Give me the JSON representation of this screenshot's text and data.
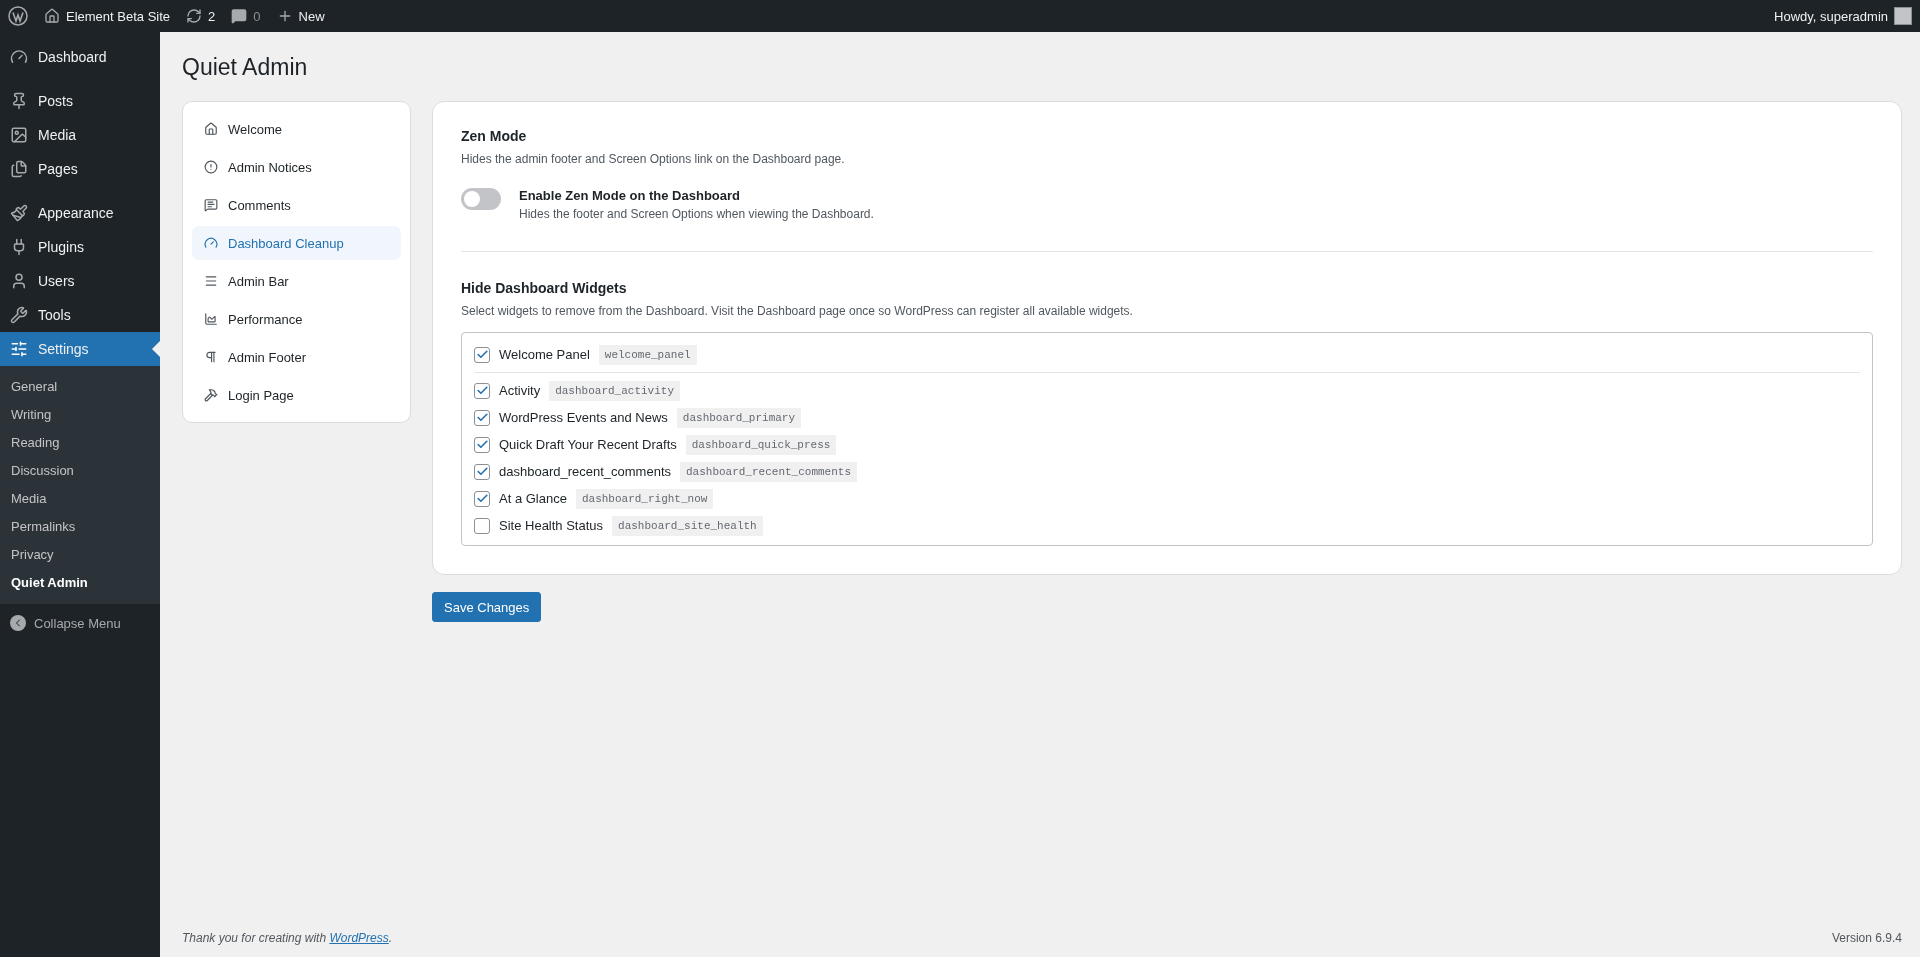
{
  "admin_bar": {
    "site_name": "Element Beta Site",
    "updates": "2",
    "comments": "0",
    "new_label": "New",
    "greeting": "Howdy, superadmin"
  },
  "sidebar": {
    "groups": [
      {
        "items": [
          {
            "label": "Dashboard",
            "selected": false
          }
        ]
      },
      {
        "items": [
          {
            "label": "Posts",
            "selected": false
          },
          {
            "label": "Media",
            "selected": false
          },
          {
            "label": "Pages",
            "selected": false
          }
        ]
      },
      {
        "items": [
          {
            "label": "Appearance",
            "selected": false
          },
          {
            "label": "Plugins",
            "selected": false
          },
          {
            "label": "Users",
            "selected": false
          },
          {
            "label": "Tools",
            "selected": false
          },
          {
            "label": "Settings",
            "selected": true
          }
        ]
      }
    ],
    "submenu": [
      {
        "label": "General",
        "selected": false
      },
      {
        "label": "Writing",
        "selected": false
      },
      {
        "label": "Reading",
        "selected": false
      },
      {
        "label": "Discussion",
        "selected": false
      },
      {
        "label": "Media",
        "selected": false
      },
      {
        "label": "Permalinks",
        "selected": false
      },
      {
        "label": "Privacy",
        "selected": false
      },
      {
        "label": "Quiet Admin",
        "selected": true
      }
    ],
    "collapse_label": "Collapse Menu"
  },
  "page_title": "Quiet Admin",
  "tabs": [
    {
      "label": "Welcome",
      "selected": false
    },
    {
      "label": "Admin Notices",
      "selected": false
    },
    {
      "label": "Comments",
      "selected": false
    },
    {
      "label": "Dashboard Cleanup",
      "selected": true
    },
    {
      "label": "Admin Bar",
      "selected": false
    },
    {
      "label": "Performance",
      "selected": false
    },
    {
      "label": "Admin Footer",
      "selected": false
    },
    {
      "label": "Login Page",
      "selected": false
    }
  ],
  "zen_mode": {
    "title": "Zen Mode",
    "description": "Hides the admin footer and Screen Options link on the Dashboard page.",
    "toggle": {
      "label": "Enable Zen Mode on the Dashboard",
      "help": "Hides the footer and Screen Options when viewing the Dashboard.",
      "on": false
    }
  },
  "widgets": {
    "title": "Hide Dashboard Widgets",
    "description": "Select widgets to remove from the Dashboard. Visit the Dashboard page once so WordPress can register all available widgets.",
    "groups": [
      {
        "items": [
          {
            "label": "Welcome Panel",
            "id": "welcome_panel",
            "checked": true
          }
        ]
      },
      {
        "items": [
          {
            "label": "Activity",
            "id": "dashboard_activity",
            "checked": true
          },
          {
            "label": "WordPress Events and News",
            "id": "dashboard_primary",
            "checked": true
          },
          {
            "label": "Quick Draft Your Recent Drafts",
            "id": "dashboard_quick_press",
            "checked": true
          },
          {
            "label": "dashboard_recent_comments",
            "id": "dashboard_recent_comments",
            "checked": true
          },
          {
            "label": "At a Glance",
            "id": "dashboard_right_now",
            "checked": true
          },
          {
            "label": "Site Health Status",
            "id": "dashboard_site_health",
            "checked": false
          }
        ]
      }
    ]
  },
  "save_button": "Save Changes",
  "footer": {
    "text": "Thank you for creating with ",
    "link": "WordPress",
    "after": ".",
    "version": "Version 6.9.4"
  }
}
